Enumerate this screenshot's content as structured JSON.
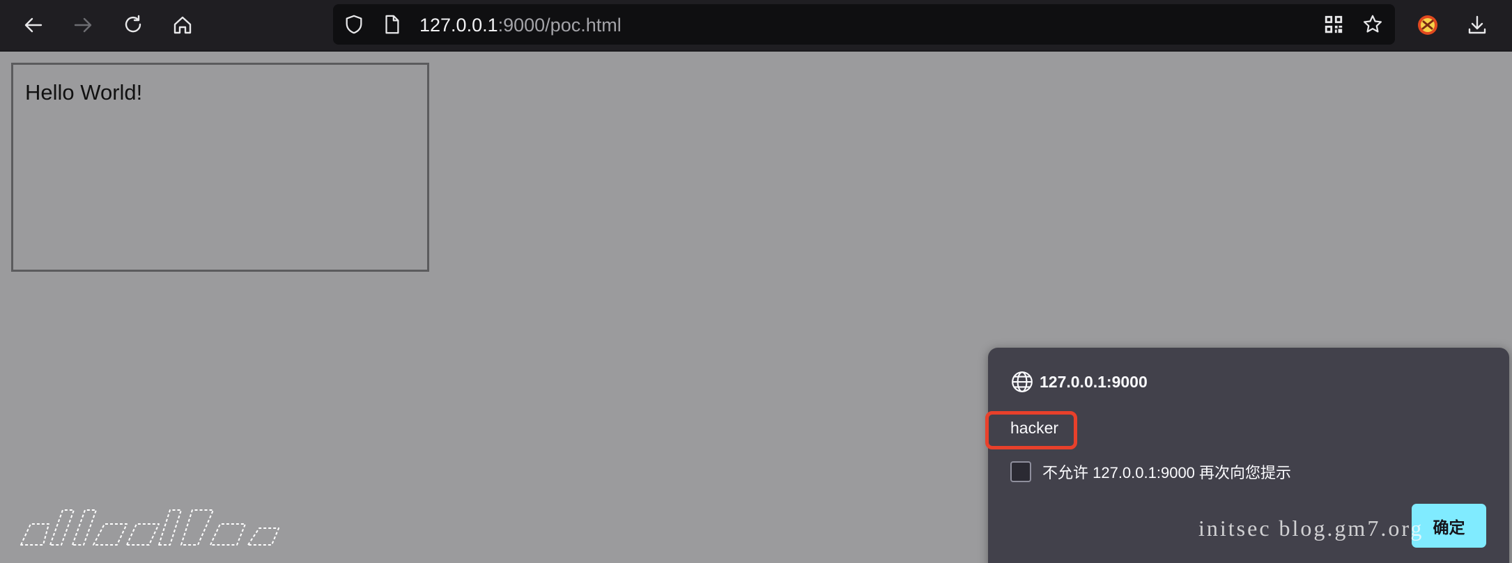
{
  "browser": {
    "url_host": "127.0.0.1",
    "url_rest": ":9000/poc.html",
    "icons": {
      "back": "arrow-left-icon",
      "forward": "arrow-right-icon",
      "reload": "reload-icon",
      "home": "home-icon",
      "tracking_protection": "shield-icon",
      "page_info": "document-icon",
      "qr_code": "qr-code-icon",
      "bookmark": "star-icon",
      "extension": "extension-icon",
      "downloads": "download-icon"
    }
  },
  "page": {
    "box_text": "Hello World!"
  },
  "dialog": {
    "origin": "127.0.0.1:9000",
    "message": "hacker",
    "checkbox_label": "不允许 127.0.0.1:9000 再次向您提示",
    "checkbox_checked": false,
    "ok_label": "确定",
    "ok_color": "#80ebff",
    "highlight_color": "#e8402b"
  },
  "watermark": {
    "blog": "initsec blog.gm7.org"
  },
  "colors": {
    "toolbar_bg": "#1f1e22",
    "urlbar_bg": "#0f0f11",
    "page_overlay": "#9b9b9d",
    "dialog_bg": "#42414b"
  }
}
